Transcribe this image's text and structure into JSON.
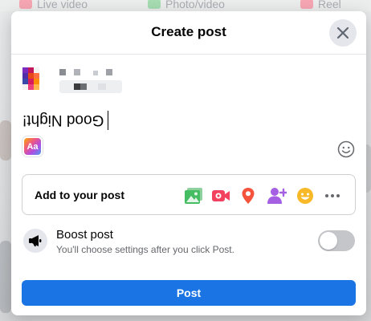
{
  "background": {
    "tabs": [
      {
        "label": "Live video",
        "icon": "live-video-icon",
        "color": "#f3425f"
      },
      {
        "label": "Photo/video",
        "icon": "photo-video-icon",
        "color": "#45bd62"
      },
      {
        "label": "Reel",
        "icon": "reel-icon",
        "color": "#f3425f"
      }
    ]
  },
  "modal": {
    "title": "Create post",
    "close_icon": "close-icon",
    "composer_text": "Good Night!",
    "text_style_label": "Aa",
    "add_to_post": {
      "label": "Add to your post",
      "icons": [
        {
          "name": "photo-video-icon",
          "color": "#45bd62"
        },
        {
          "name": "live-video-icon",
          "color": "#f3425f"
        },
        {
          "name": "location-pin-icon",
          "color": "#f5533d"
        },
        {
          "name": "tag-people-icon",
          "color": "#a55fe3"
        },
        {
          "name": "feeling-emoji-icon",
          "color": "#f7b928"
        },
        {
          "name": "more-options-icon",
          "color": "#65676b"
        }
      ]
    },
    "boost": {
      "title": "Boost post",
      "subtitle": "You'll choose settings after you click Post.",
      "toggle_on": false
    },
    "post_button": "Post"
  },
  "colors": {
    "accent": "#1b74e4",
    "text_primary": "#050505",
    "text_secondary": "#65676b"
  }
}
